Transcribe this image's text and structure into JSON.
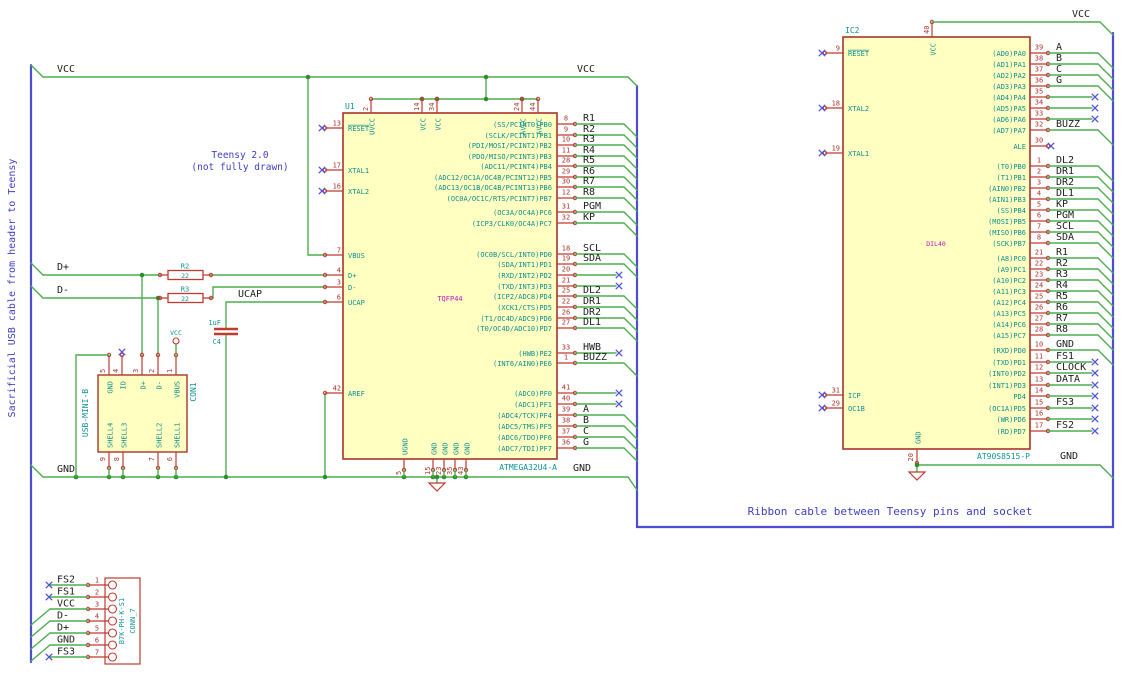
{
  "colors": {
    "wire": "#4fae4f",
    "junction": "#2f8f2f",
    "bus": "#4d4dd0",
    "component_outline": "#a8352a",
    "component_outline2": "#c03a30",
    "component_fill": "#ffffc2",
    "pin_name": "#0f8e8e",
    "pin_number": "#a8352a",
    "net_label": "#202020",
    "no_connect": "#5353dd",
    "note": "#4040c8",
    "value_text": "#0d9494",
    "footprint_text": "#c018c0"
  },
  "notes": {
    "left_cable": "Sacrificial USB cable from header to Teensy",
    "teensy_line1": "Teensy 2.0",
    "teensy_line2": "(not fully drawn)",
    "ribbon_cable": "Ribbon cable between Teensy pins and socket"
  },
  "nets": {
    "vcc": "VCC",
    "gnd": "GND",
    "dplus": "D+",
    "dminus": "D-",
    "ucap": "UCAP"
  },
  "u1": {
    "reference": "U1",
    "value": "ATMEGA32U4-A",
    "footprint": "TQFP44",
    "top_pins": [
      {
        "num": "2",
        "name": "UVCC"
      },
      {
        "num": "14",
        "name": "VCC"
      },
      {
        "num": "34",
        "name": "VCC"
      },
      {
        "num": "24",
        "name": "AVCC"
      },
      {
        "num": "44",
        "name": "AVCC"
      }
    ],
    "bottom_pins": [
      {
        "num": "5",
        "name": "UGND"
      },
      {
        "num": "15",
        "name": "GND"
      },
      {
        "num": "23",
        "name": "GND"
      },
      {
        "num": "35",
        "name": "GND"
      },
      {
        "num": "43",
        "name": "GND"
      }
    ],
    "left_pins": [
      {
        "num": "13",
        "name": "RESET",
        "nc": true,
        "overline": true
      },
      {
        "num": "17",
        "name": "XTAL1",
        "nc": true
      },
      {
        "num": "16",
        "name": "XTAL2",
        "nc": true
      },
      {
        "num": "7",
        "name": "VBUS"
      },
      {
        "num": "4",
        "name": "D+"
      },
      {
        "num": "3",
        "name": "D-"
      },
      {
        "num": "6",
        "name": "UCAP"
      },
      {
        "num": "42",
        "name": "AREF"
      }
    ],
    "right_pins": [
      {
        "num": "8",
        "name": "(SS/PCINT0)PB0",
        "label": "R1"
      },
      {
        "num": "9",
        "name": "(SCLK/PCINT1)PB1",
        "label": "R2"
      },
      {
        "num": "10",
        "name": "(PDI/MOSI/PCINT2)PB2",
        "label": "R3"
      },
      {
        "num": "11",
        "name": "(PDO/MISO/PCINT3)PB3",
        "label": "R4"
      },
      {
        "num": "28",
        "name": "(ADC11/PCINT4)PB4",
        "label": "R5"
      },
      {
        "num": "29",
        "name": "(ADC12/OC1A/OC4B/PCINT12)PB5",
        "label": "R6"
      },
      {
        "num": "30",
        "name": "(ADC13/OC1B/OC4B/PCINT13)PB6",
        "label": "R7"
      },
      {
        "num": "12",
        "name": "(OC0A/OC1C/RTS/PCINT7)PB7",
        "label": "R8"
      },
      {
        "num": "31",
        "name": "(OC3A/OC4A)PC6",
        "label": "PGM"
      },
      {
        "num": "32",
        "name": "(ICP3/CLK0/OC4A)PC7",
        "label": "KP"
      },
      {
        "num": "18",
        "name": "(OC0B/SCL/INT0)PD0",
        "label": "SCL"
      },
      {
        "num": "19",
        "name": "(SDA/INT1)PD1",
        "label": "SDA"
      },
      {
        "num": "20",
        "name": "(RXD/INT2)PD2",
        "nc": true
      },
      {
        "num": "21",
        "name": "(TXD/INT3)PD3",
        "nc": true
      },
      {
        "num": "25",
        "name": "(ICP2/ADC8)PD4",
        "label": "DL2"
      },
      {
        "num": "22",
        "name": "(XCK1/CTS)PD5",
        "label": "DR1"
      },
      {
        "num": "26",
        "name": "(T1/OC4D/ADC9)PD6",
        "label": "DR2"
      },
      {
        "num": "27",
        "name": "(T0/OC4D/ADC10)PD7",
        "label": "DL1"
      },
      {
        "num": "33",
        "name": "(HWB)PE2",
        "label": "HWB",
        "nc": true
      },
      {
        "num": "1",
        "name": "(INT6/AIN0)PE6",
        "label": "BUZZ"
      },
      {
        "num": "41",
        "name": "(ADC0)PF0",
        "nc": true
      },
      {
        "num": "40",
        "name": "(ADC1)PF1",
        "nc": true
      },
      {
        "num": "39",
        "name": "(ADC4/TCK)PF4",
        "label": "A"
      },
      {
        "num": "38",
        "name": "(ADC5/TMS)PF5",
        "label": "B"
      },
      {
        "num": "37",
        "name": "(ADC6/TDO)PF6",
        "label": "C"
      },
      {
        "num": "36",
        "name": "(ADC7/TDI)PF7",
        "label": "G"
      }
    ]
  },
  "ic2": {
    "reference": "IC2",
    "value": "AT90S8515-P",
    "footprint": "DIL40",
    "top_pin": {
      "num": "40",
      "name": "VCC"
    },
    "bottom_pin": {
      "num": "20",
      "name": "GND"
    },
    "left_pins": [
      {
        "num": "9",
        "name": "RESET",
        "nc": true,
        "overline": true
      },
      {
        "num": "18",
        "name": "XTAL2",
        "nc": true
      },
      {
        "num": "19",
        "name": "XTAL1",
        "nc": true
      },
      {
        "num": "31",
        "name": "ICP",
        "nc": true
      },
      {
        "num": "29",
        "name": "OC1B",
        "nc": true
      }
    ],
    "right_pins": [
      {
        "num": "39",
        "name": "(AD0)PA0",
        "label": "A"
      },
      {
        "num": "38",
        "name": "(AD1)PA1",
        "label": "B"
      },
      {
        "num": "37",
        "name": "(AD2)PA2",
        "label": "C"
      },
      {
        "num": "36",
        "name": "(AD3)PA3",
        "label": "G"
      },
      {
        "num": "35",
        "name": "(AD4)PA4",
        "nc": true
      },
      {
        "num": "34",
        "name": "(AD5)PA5",
        "nc": true
      },
      {
        "num": "33",
        "name": "(AD6)PA6",
        "nc": true
      },
      {
        "num": "32",
        "name": "(AD7)PA7",
        "label": "BUZZ"
      },
      {
        "num": "30",
        "name": "ALE",
        "nc": true,
        "nc_at_pin": true
      },
      {
        "num": "1",
        "name": "(T0)PB0",
        "label": "DL2"
      },
      {
        "num": "2",
        "name": "(T1)PB1",
        "label": "DR1"
      },
      {
        "num": "3",
        "name": "(AIN0)PB2",
        "label": "DR2"
      },
      {
        "num": "4",
        "name": "(AIN1)PB3",
        "label": "DL1"
      },
      {
        "num": "5",
        "name": "(SS)PB4",
        "label": "KP"
      },
      {
        "num": "6",
        "name": "(MOSI)PB5",
        "label": "PGM"
      },
      {
        "num": "7",
        "name": "(MISO)PB6",
        "label": "SCL"
      },
      {
        "num": "8",
        "name": "(SCK)PB7",
        "label": "SDA"
      },
      {
        "num": "21",
        "name": "(A8)PC0",
        "label": "R1"
      },
      {
        "num": "22",
        "name": "(A9)PC1",
        "label": "R2"
      },
      {
        "num": "23",
        "name": "(A10)PC2",
        "label": "R3"
      },
      {
        "num": "24",
        "name": "(A11)PC3",
        "label": "R4"
      },
      {
        "num": "25",
        "name": "(A12)PC4",
        "label": "R5"
      },
      {
        "num": "26",
        "name": "(A13)PC5",
        "label": "R6"
      },
      {
        "num": "27",
        "name": "(A14)PC6",
        "label": "R7"
      },
      {
        "num": "28",
        "name": "(A15)PC7",
        "label": "R8"
      },
      {
        "num": "10",
        "name": "(RXD)PD0",
        "label": "GND"
      },
      {
        "num": "11",
        "name": "(TXD)PD1",
        "label": "FS1",
        "nc": true
      },
      {
        "num": "12",
        "name": "(INT0)PD2",
        "label": "CLOCK",
        "nc": true
      },
      {
        "num": "13",
        "name": "(INT1)PD3",
        "label": "DATA",
        "nc": true
      },
      {
        "num": "14",
        "name": "PD4",
        "nc": true
      },
      {
        "num": "15",
        "name": "(OC1A)PD5",
        "label": "FS3",
        "nc": true
      },
      {
        "num": "16",
        "name": "(WR)PD6",
        "nc": true
      },
      {
        "num": "17",
        "name": "(RD)PD7",
        "label": "FS2",
        "nc": true
      }
    ]
  },
  "r2": {
    "reference": "R2",
    "value": "22"
  },
  "r3": {
    "reference": "R3",
    "value": "22"
  },
  "c4": {
    "reference": "C4",
    "value": "1uF"
  },
  "usb": {
    "reference": "CON1",
    "value": "USB-MINI-B",
    "power_symbol": "VCC",
    "top_pins": [
      {
        "num": "5",
        "name": "GND"
      },
      {
        "num": "4",
        "name": "ID",
        "nc": true
      },
      {
        "num": "3",
        "name": "D+"
      },
      {
        "num": "2",
        "name": "D-"
      },
      {
        "num": "1",
        "name": "VBUS"
      }
    ],
    "bottom_pins": [
      {
        "num": "9",
        "name": "SHELL4"
      },
      {
        "num": "8",
        "name": "SHELL3"
      },
      {
        "num": "7",
        "name": "SHELL2"
      },
      {
        "num": "6",
        "name": "SHELL1"
      }
    ]
  },
  "conn7": {
    "reference": "CONN_7",
    "value": "B7K-PH-K-S1",
    "pins": [
      {
        "num": "1",
        "label": "FS2",
        "nc": true
      },
      {
        "num": "2",
        "label": "FS1",
        "nc": true
      },
      {
        "num": "3",
        "label": "VCC"
      },
      {
        "num": "4",
        "label": "D-"
      },
      {
        "num": "5",
        "label": "D+"
      },
      {
        "num": "6",
        "label": "GND"
      },
      {
        "num": "7",
        "label": "FS3",
        "nc": true
      }
    ]
  }
}
